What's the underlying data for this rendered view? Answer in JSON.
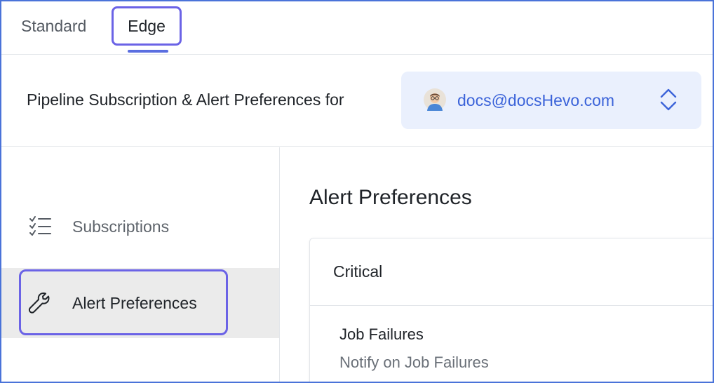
{
  "tabs": [
    {
      "label": "Standard",
      "active": false
    },
    {
      "label": "Edge",
      "active": true
    }
  ],
  "header": {
    "title": "Pipeline Subscription & Alert Preferences for",
    "user_email": "docs@docsHevo.com"
  },
  "sidebar": {
    "items": [
      {
        "label": "Subscriptions",
        "icon": "checklist-icon",
        "active": false
      },
      {
        "label": "Alert Preferences",
        "icon": "wrench-icon",
        "active": true
      }
    ]
  },
  "main": {
    "title": "Alert Preferences",
    "section": {
      "label": "Critical",
      "rows": [
        {
          "title": "Job Failures",
          "description": "Notify on Job Failures"
        }
      ]
    }
  },
  "colors": {
    "accent_outline": "#6b63e6",
    "link_blue": "#3b63d9",
    "selector_bg": "#eaf0fd",
    "sidebar_active_bg": "#ebebeb"
  }
}
